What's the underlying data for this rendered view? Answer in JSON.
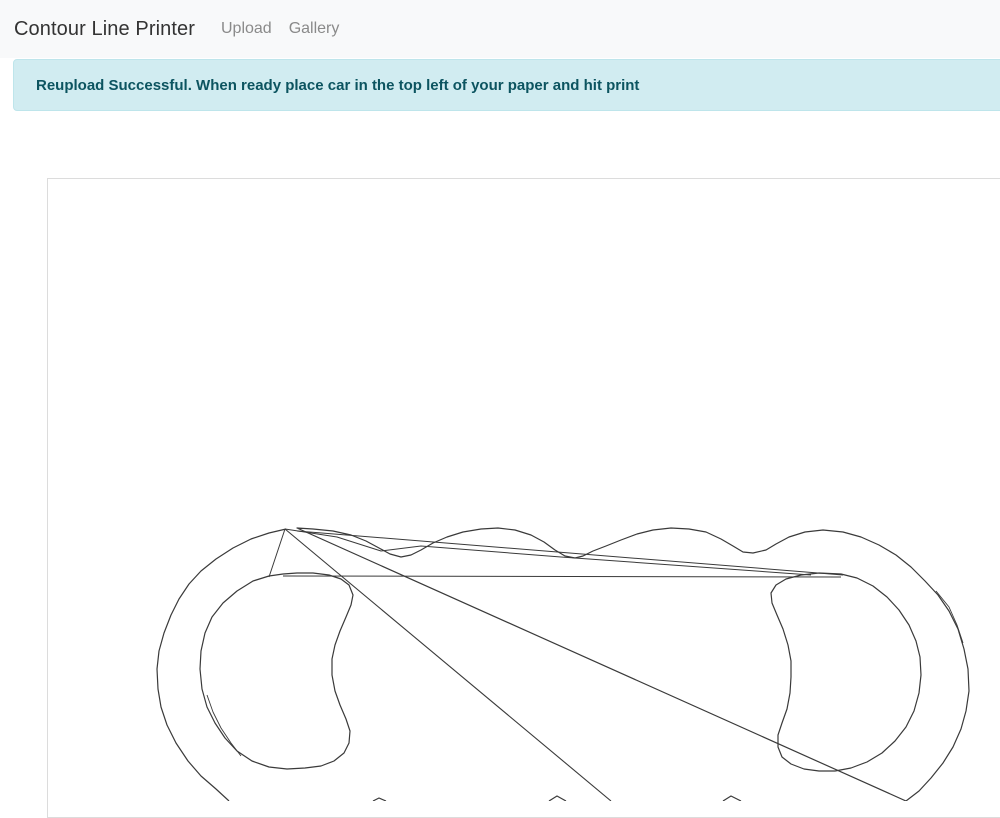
{
  "navbar": {
    "brand": "Contour Line Printer",
    "links": [
      "Upload",
      "Gallery"
    ]
  },
  "alert": {
    "message": "Reupload Successful. When ready place car in the top left of your paper and hit print",
    "type": "info"
  },
  "colors": {
    "navbar_bg": "#f8f9fa",
    "alert_bg": "#d1ecf1",
    "alert_text": "#0c5460",
    "drawing_stroke": "#3a3a3a"
  }
}
